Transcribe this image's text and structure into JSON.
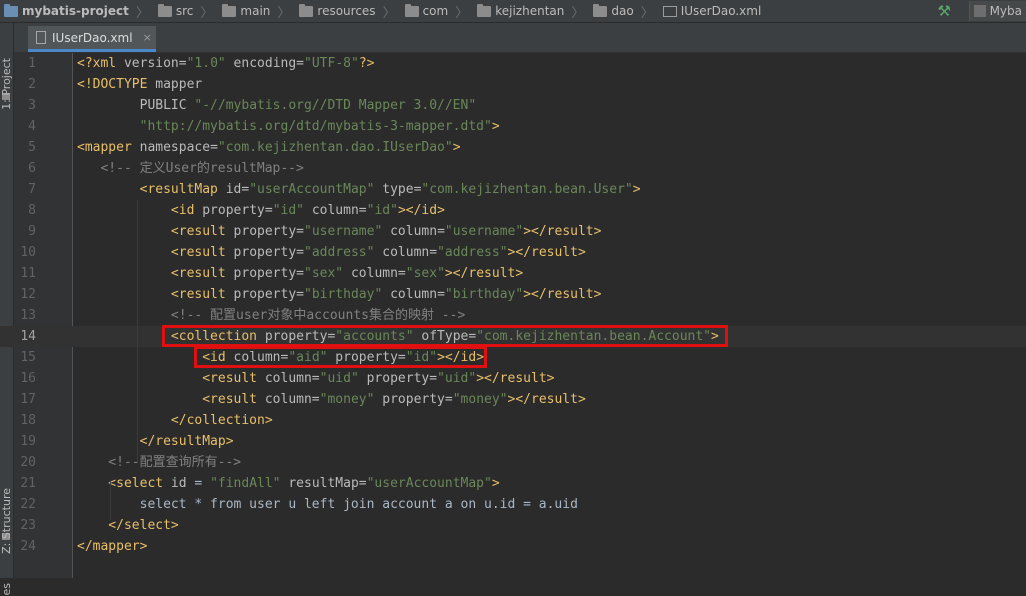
{
  "breadcrumb": [
    {
      "label": "mybatis-project",
      "icon": "project-folder-icon"
    },
    {
      "label": "src",
      "icon": "folder-icon"
    },
    {
      "label": "main",
      "icon": "folder-icon"
    },
    {
      "label": "resources",
      "icon": "resources-folder-icon"
    },
    {
      "label": "com",
      "icon": "folder-icon"
    },
    {
      "label": "kejizhentan",
      "icon": "folder-icon"
    },
    {
      "label": "dao",
      "icon": "folder-icon"
    },
    {
      "label": "IUserDao.xml",
      "icon": "xml-file-icon"
    }
  ],
  "toolbar": {
    "run_config_label": "Myba",
    "build_icon": "hammer-icon"
  },
  "side_tabs": {
    "project": "1: Project",
    "structure": "Z: Structure",
    "favorites": "es"
  },
  "editor_tab": {
    "label": "IUserDao.xml",
    "close": "×"
  },
  "current_line": 14,
  "lines": [
    [
      [
        "t",
        "<?xml "
      ],
      [
        "a",
        "version="
      ],
      [
        "v",
        "\"1.0\""
      ],
      [
        "a",
        " encoding="
      ],
      [
        "v",
        "\"UTF-8\""
      ],
      [
        "t",
        "?>"
      ]
    ],
    [
      [
        "t",
        "<!"
      ],
      [
        "t",
        "DOCTYPE"
      ],
      [
        "a",
        " mapper"
      ]
    ],
    [
      [
        "a",
        "        PUBLIC "
      ],
      [
        "v",
        "\"-//mybatis.org//DTD Mapper 3.0//EN\""
      ]
    ],
    [
      [
        "v",
        "        \"http://mybatis.org/dtd/mybatis-3-mapper.dtd\""
      ],
      [
        "t",
        ">"
      ]
    ],
    [
      [
        "t",
        "<mapper "
      ],
      [
        "a",
        "namespace="
      ],
      [
        "v",
        "\"com.kejizhentan.dao.IUserDao\""
      ],
      [
        "t",
        ">"
      ]
    ],
    [
      [
        "c",
        "   <!-- 定义User的resultMap-->"
      ]
    ],
    [
      [
        "t",
        "        <resultMap "
      ],
      [
        "a",
        "id="
      ],
      [
        "v",
        "\"userAccountMap\""
      ],
      [
        "a",
        " type="
      ],
      [
        "v",
        "\"com.kejizhentan.bean.User\""
      ],
      [
        "t",
        ">"
      ]
    ],
    [
      [
        "t",
        "            <id "
      ],
      [
        "a",
        "property="
      ],
      [
        "v",
        "\"id\""
      ],
      [
        "a",
        " column="
      ],
      [
        "v",
        "\"id\""
      ],
      [
        "t",
        "></id>"
      ]
    ],
    [
      [
        "t",
        "            <result "
      ],
      [
        "a",
        "property="
      ],
      [
        "v",
        "\"username\""
      ],
      [
        "a",
        " column="
      ],
      [
        "v",
        "\"username\""
      ],
      [
        "t",
        "></result>"
      ]
    ],
    [
      [
        "t",
        "            <result "
      ],
      [
        "a",
        "property="
      ],
      [
        "v",
        "\"address\""
      ],
      [
        "a",
        " column="
      ],
      [
        "v",
        "\"address\""
      ],
      [
        "t",
        "></result>"
      ]
    ],
    [
      [
        "t",
        "            <result "
      ],
      [
        "a",
        "property="
      ],
      [
        "v",
        "\"sex\""
      ],
      [
        "a",
        " column="
      ],
      [
        "v",
        "\"sex\""
      ],
      [
        "t",
        "></result>"
      ]
    ],
    [
      [
        "t",
        "            <result "
      ],
      [
        "a",
        "property="
      ],
      [
        "v",
        "\"birthday\""
      ],
      [
        "a",
        " column="
      ],
      [
        "v",
        "\"birthday\""
      ],
      [
        "t",
        "></result>"
      ]
    ],
    [
      [
        "c",
        "            <!-- 配置user对象中accounts集合的映射 -->"
      ]
    ],
    [
      [
        "t",
        "            <collection "
      ],
      [
        "a",
        "property="
      ],
      [
        "v",
        "\"accounts\""
      ],
      [
        "a",
        " ofType="
      ],
      [
        "v",
        "\"com.kejizhentan.bean.Account\""
      ],
      [
        "t",
        ">"
      ]
    ],
    [
      [
        "t",
        "                <id "
      ],
      [
        "a",
        "column="
      ],
      [
        "v",
        "\"aid\""
      ],
      [
        "a",
        " property="
      ],
      [
        "v",
        "\"id\""
      ],
      [
        "t",
        "></id>"
      ]
    ],
    [
      [
        "t",
        "                <result "
      ],
      [
        "a",
        "column="
      ],
      [
        "v",
        "\"uid\""
      ],
      [
        "a",
        " property="
      ],
      [
        "v",
        "\"uid\""
      ],
      [
        "t",
        "></result>"
      ]
    ],
    [
      [
        "t",
        "                <result "
      ],
      [
        "a",
        "column="
      ],
      [
        "v",
        "\"money\""
      ],
      [
        "a",
        " property="
      ],
      [
        "v",
        "\"money\""
      ],
      [
        "t",
        "></result>"
      ]
    ],
    [
      [
        "t",
        "            </collection>"
      ]
    ],
    [
      [
        "t",
        "        </resultMap>"
      ]
    ],
    [
      [
        "c",
        "    <!--配置查询所有-->"
      ]
    ],
    [
      [
        "t",
        "    <select "
      ],
      [
        "a",
        "id "
      ],
      [
        "x",
        "= "
      ],
      [
        "v",
        "\"findAll\""
      ],
      [
        "a",
        " resultMap="
      ],
      [
        "v",
        "\"userAccountMap\""
      ],
      [
        "t",
        ">"
      ]
    ],
    [
      [
        "x",
        "        select * from user u left join account a on u.id = a.uid"
      ]
    ],
    [
      [
        "t",
        "    </select>"
      ]
    ],
    [
      [
        "t",
        "</mapper>"
      ]
    ]
  ]
}
